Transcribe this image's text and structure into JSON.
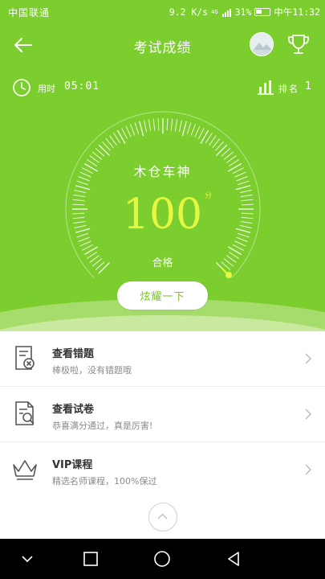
{
  "status_bar": {
    "carrier": "中国联通",
    "speed": "9.2 K/s",
    "network": "4G",
    "battery": "31%",
    "time": "中午11:32"
  },
  "nav": {
    "title": "考试成绩"
  },
  "info": {
    "duration_label": "用时",
    "duration_value": "05:01",
    "rank_label": "排名",
    "rank_value": "1"
  },
  "gauge": {
    "name": "木仓车神",
    "score": "100",
    "unit": "分",
    "status": "合格",
    "fraction": 1.0
  },
  "show_button": "炫耀一下",
  "list": [
    {
      "title": "查看错题",
      "subtitle": "棒极啦，没有错题哦",
      "icon": "wrong-answers-icon"
    },
    {
      "title": "查看试卷",
      "subtitle": "恭喜满分通过，真是厉害!",
      "icon": "exam-paper-icon"
    },
    {
      "title": "VIP课程",
      "subtitle": "精选名师课程，100%保过",
      "icon": "vip-crown-icon"
    }
  ],
  "colors": {
    "primary_green": "#7ccd2e",
    "score_yellow": "#e5f740"
  }
}
